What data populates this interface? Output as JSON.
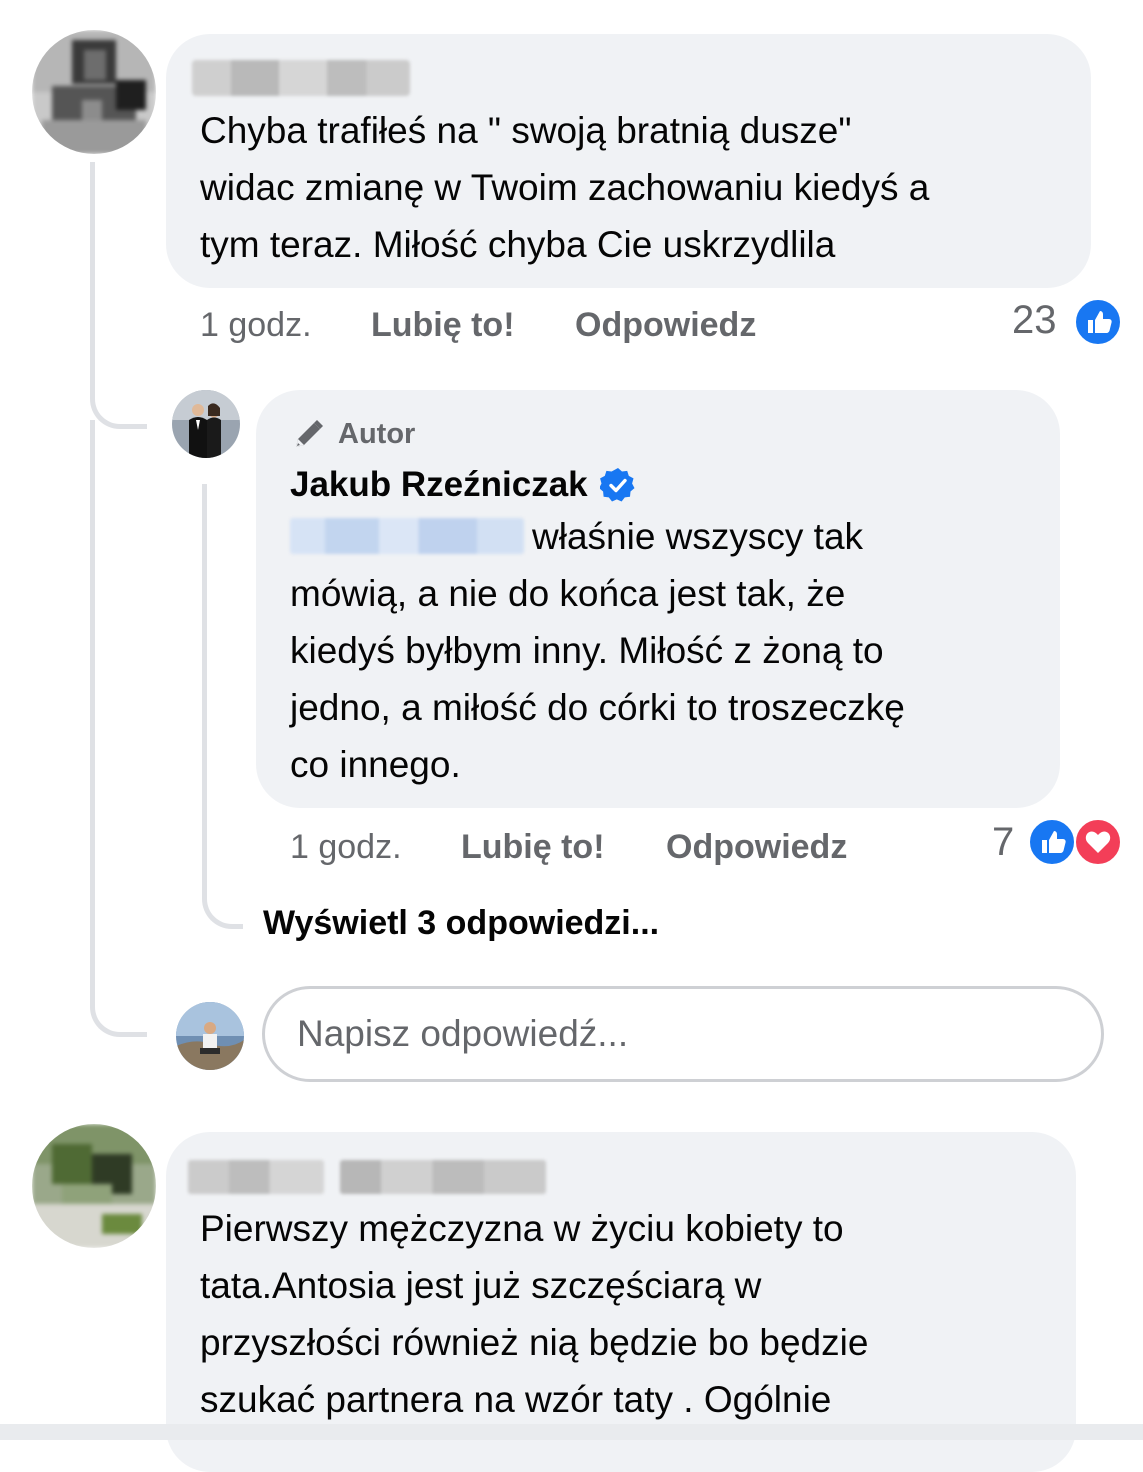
{
  "comments": [
    {
      "text": "Chyba trafiłeś na \" swoją bratnią dusze\"\nwidac zmianę w Twoim zachowaniu kiedyś a\ntym teraz. Miłość chyba Cie uskrzydlila",
      "time": "1 godz.",
      "like_label": "Lubię to!",
      "reply_label": "Odpowiedz",
      "reaction_count": "23"
    },
    {
      "badge": "Autor",
      "author": "Jakub Rzeźniczak",
      "text_first": "właśnie wszyscy tak",
      "text_rest": "mówią, a nie do końca jest tak, że\nkiedyś byłbym inny. Miłość z żoną to\njedno, a miłość do córki to troszeczkę\nco innego.",
      "time": "1 godz.",
      "like_label": "Lubię to!",
      "reply_label": "Odpowiedz",
      "reaction_count": "7"
    },
    {
      "text": "Pierwszy mężczyzna w życiu kobiety to\ntata.Antosia jest już szczęściarą w\nprzyszłości również nią  będzie bo  będzie\nszukać partnera na wzór taty . Ogólnie"
    }
  ],
  "view_replies": "Wyświetl 3 odpowiedzi...",
  "reply_input": {
    "placeholder": "Napisz odpowiedź..."
  },
  "colors": {
    "bubble": "#f0f2f5",
    "like_blue": "#1877f2",
    "heart_red": "#f33e58",
    "verified": "#1877f2"
  },
  "icons": [
    "pen-icon",
    "verified-badge-icon",
    "like-reaction-icon",
    "love-reaction-icon"
  ]
}
